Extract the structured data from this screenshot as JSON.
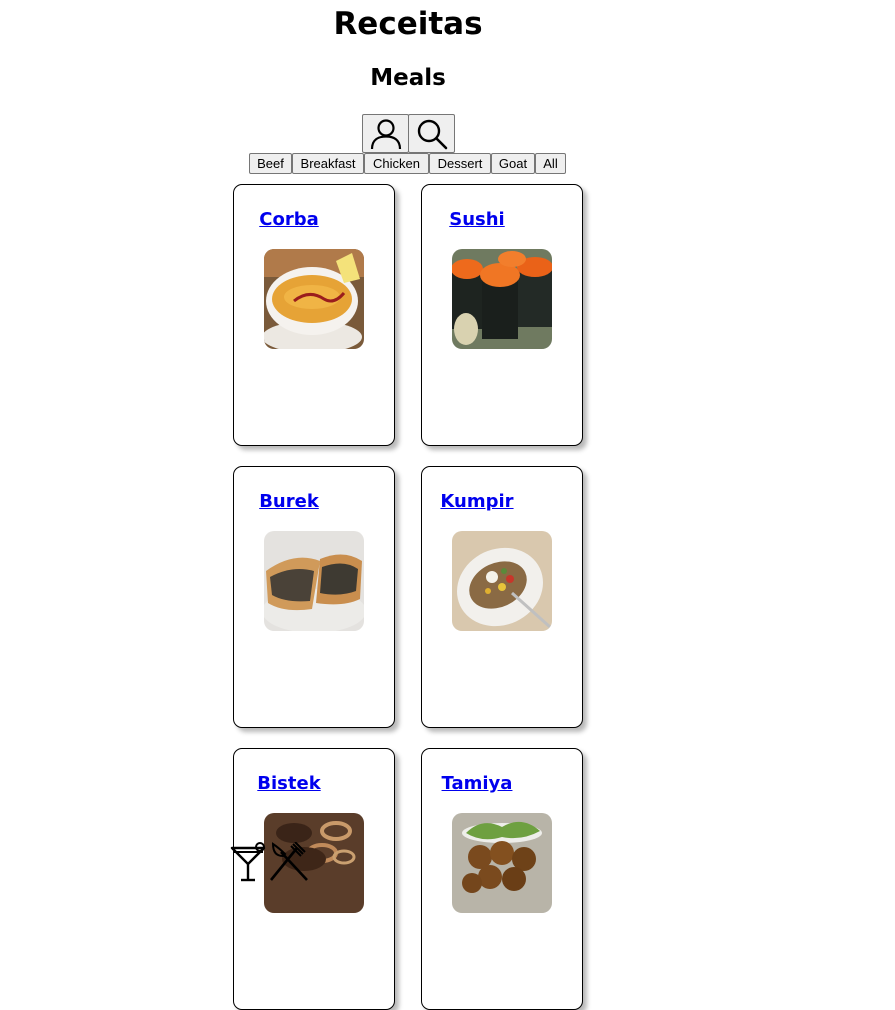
{
  "header": {
    "title": "Receitas",
    "subtitle": "Meals"
  },
  "toolbar": {
    "icons": [
      "profile-icon",
      "search-icon"
    ]
  },
  "categories": [
    "Beef",
    "Breakfast",
    "Chicken",
    "Dessert",
    "Goat",
    "All"
  ],
  "recipes": [
    {
      "name": "Corba"
    },
    {
      "name": "Sushi"
    },
    {
      "name": "Burek"
    },
    {
      "name": "Kumpir"
    },
    {
      "name": "Bistek"
    },
    {
      "name": "Tamiya"
    }
  ],
  "footer": {
    "icons": [
      "drink-icon",
      "meal-icon"
    ]
  },
  "colors": {
    "link": "#0000ee",
    "button_bg": "#efefef",
    "button_border": "#767676"
  }
}
